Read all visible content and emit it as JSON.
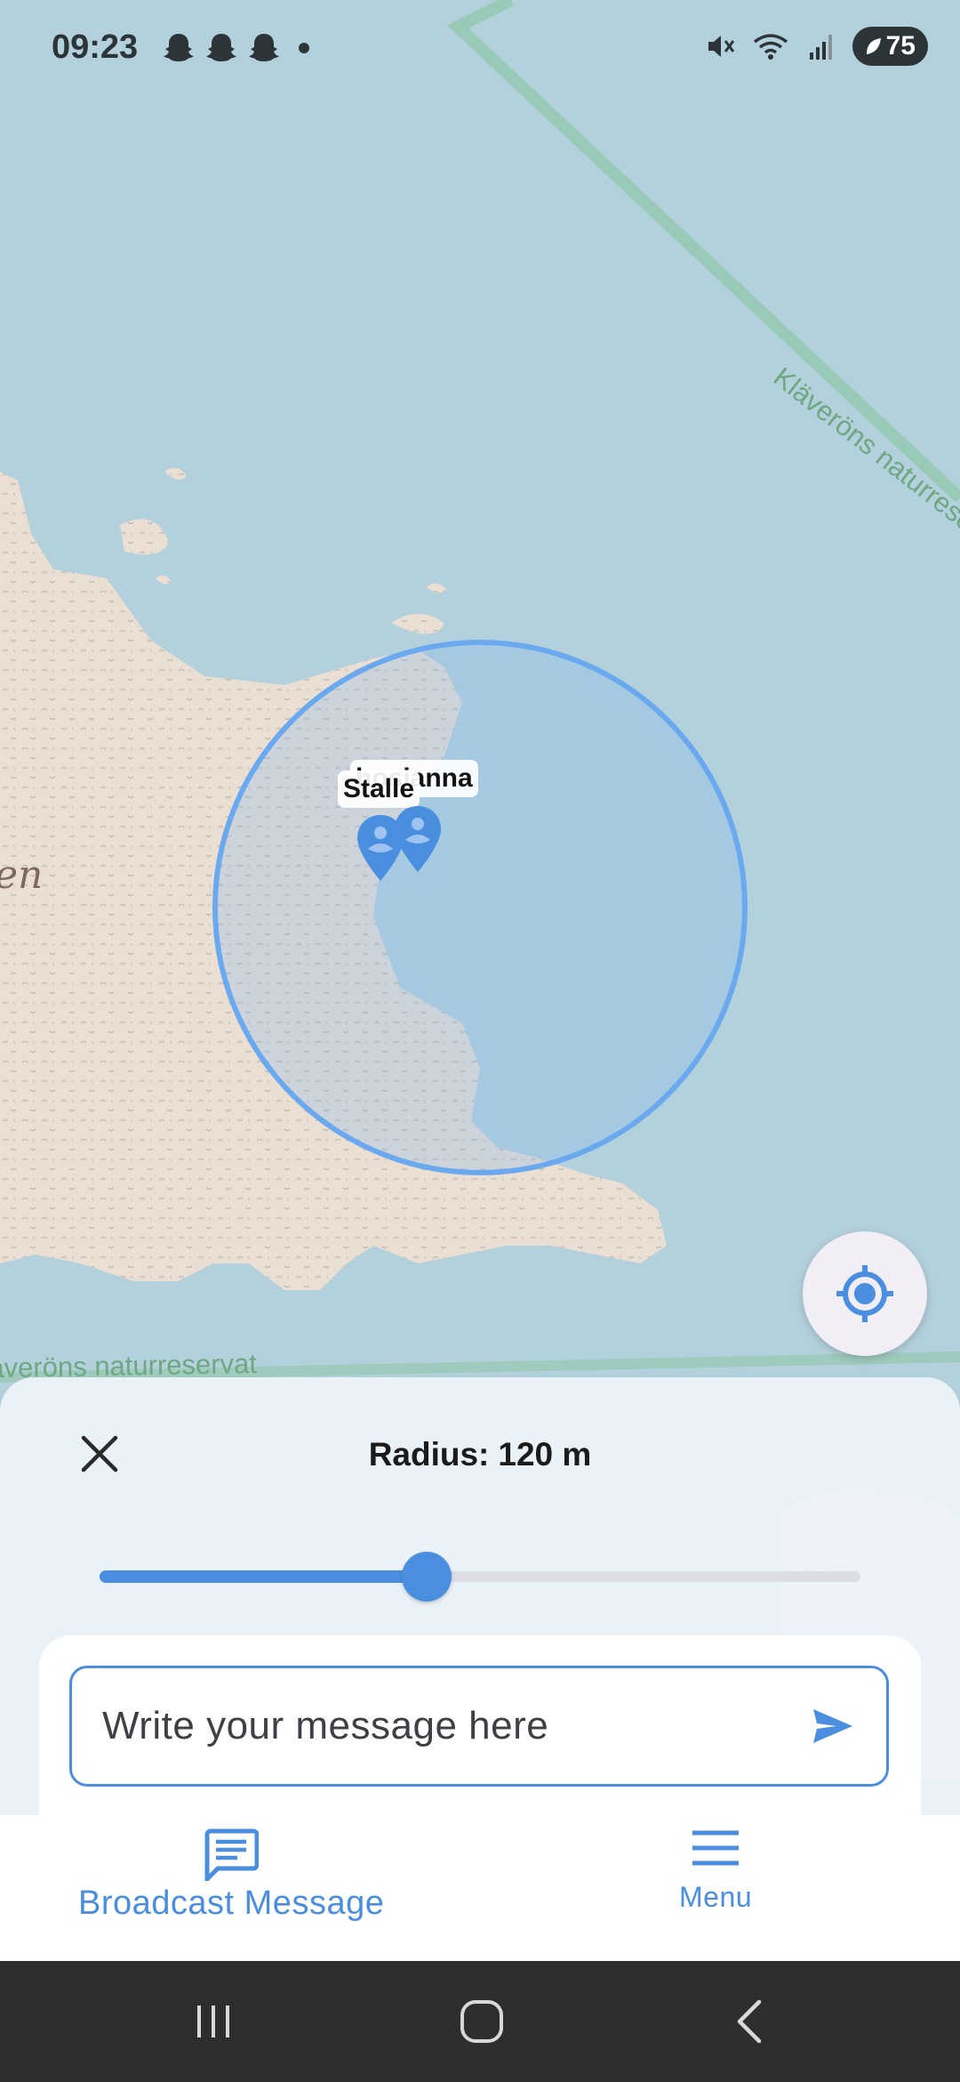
{
  "status_bar": {
    "time": "09:23",
    "notification_icons": [
      "snapchat-icon",
      "snapchat-icon",
      "snapchat-icon",
      "dot-icon"
    ],
    "right_icons": [
      "mute-icon",
      "wifi-icon",
      "signal-icon"
    ],
    "battery": "75"
  },
  "map": {
    "region_label_top": "Kläveröns naturreservat",
    "region_label_bottom": "Kläveröns naturreservat",
    "island_label_fragment": "en",
    "markers": [
      {
        "label": "hosianna"
      },
      {
        "label": "Stalle"
      }
    ],
    "colors": {
      "water": "#b3d1dc",
      "land": "#ebdfd3",
      "reserve_border": "#8fc7a8",
      "radius_circle": "#6aa9ef",
      "marker": "#4a8ee0"
    }
  },
  "locate_button": {
    "icon": "my-location-icon"
  },
  "sheet": {
    "close_icon": "close-icon",
    "radius_label": "Radius:",
    "radius_value": "120 m",
    "slider_fraction": 0.43,
    "message_placeholder": "Write your message here",
    "send_icon": "send-icon"
  },
  "bottom_nav": {
    "items": [
      {
        "label": "Broadcast Message",
        "icon": "chat-bubble-icon",
        "active": true
      },
      {
        "label": "Menu",
        "icon": "hamburger-menu-icon",
        "active": false
      }
    ],
    "accent": "#4a8ee0"
  },
  "system_nav": {
    "buttons": [
      "recent-apps-icon",
      "home-icon",
      "back-icon"
    ]
  }
}
